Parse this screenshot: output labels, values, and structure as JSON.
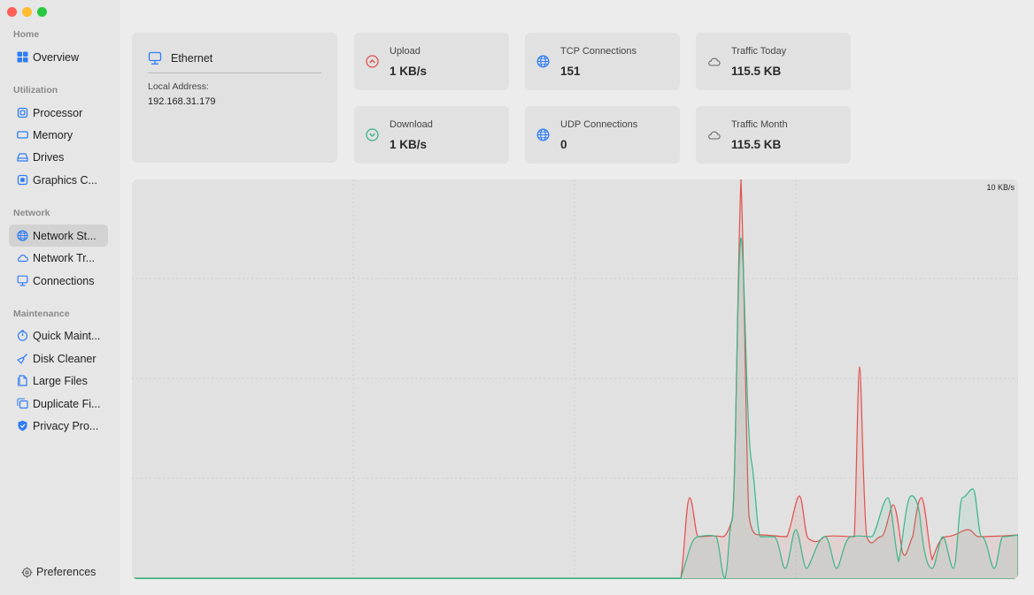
{
  "sidebar": {
    "sections": [
      {
        "title": "Home",
        "items": [
          {
            "label": "Overview",
            "icon": "grid-icon"
          }
        ]
      },
      {
        "title": "Utilization",
        "items": [
          {
            "label": "Processor",
            "icon": "cpu-icon"
          },
          {
            "label": "Memory",
            "icon": "memory-icon"
          },
          {
            "label": "Drives",
            "icon": "drive-icon"
          },
          {
            "label": "Graphics C...",
            "icon": "gpu-icon"
          }
        ]
      },
      {
        "title": "Network",
        "items": [
          {
            "label": "Network St...",
            "icon": "globe-icon",
            "active": true
          },
          {
            "label": "Network Tr...",
            "icon": "cloud-icon"
          },
          {
            "label": "Connections",
            "icon": "monitor-icon"
          }
        ]
      },
      {
        "title": "Maintenance",
        "items": [
          {
            "label": "Quick Maint...",
            "icon": "timer-icon"
          },
          {
            "label": "Disk Cleaner",
            "icon": "broom-icon"
          },
          {
            "label": "Large Files",
            "icon": "files-icon"
          },
          {
            "label": "Duplicate Fi...",
            "icon": "duplicate-icon"
          },
          {
            "label": "Privacy Pro...",
            "icon": "shield-icon"
          }
        ]
      }
    ],
    "preferences_label": "Preferences"
  },
  "ethernet": {
    "title": "Ethernet",
    "address_label": "Local Address:",
    "address_value": "192.168.31.179"
  },
  "stats": {
    "upload": {
      "label": "Upload",
      "value": "1 KB/s"
    },
    "download": {
      "label": "Download",
      "value": "1 KB/s"
    },
    "tcp": {
      "label": "TCP Connections",
      "value": "151"
    },
    "udp": {
      "label": "UDP Connections",
      "value": "0"
    },
    "traffic_today": {
      "label": "Traffic Today",
      "value": "115.5 KB"
    },
    "traffic_month": {
      "label": "Traffic Month",
      "value": "115.5 KB"
    }
  },
  "colors": {
    "accent": "#2f7cf6",
    "upload": "#e0504c",
    "download": "#3bb589"
  },
  "chart": {
    "max_label": "10 KB/s"
  }
}
